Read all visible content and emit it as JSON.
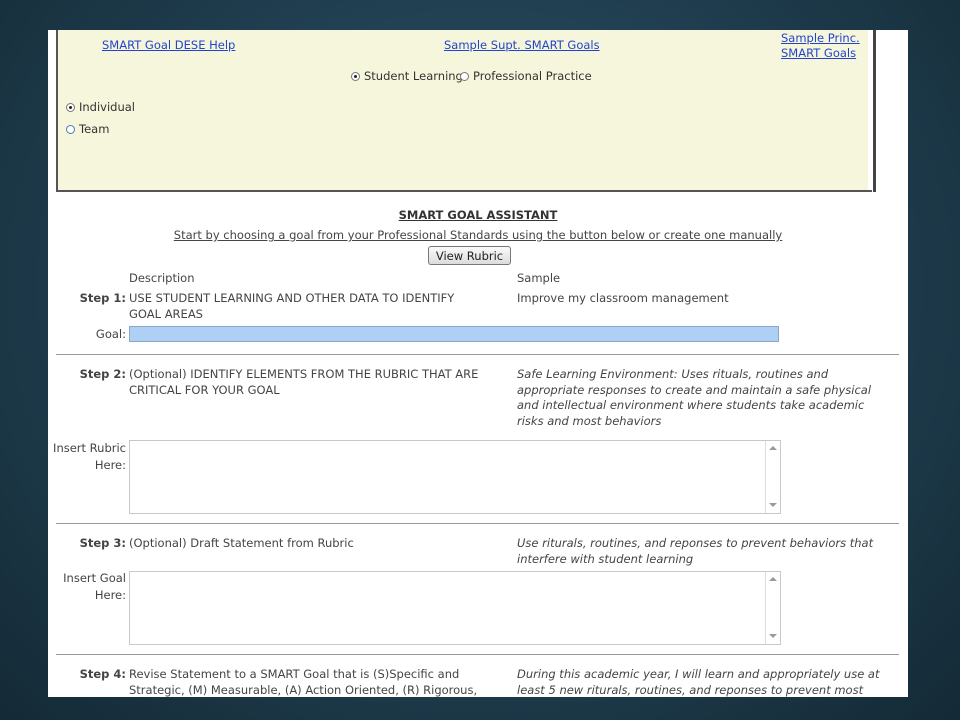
{
  "links": {
    "dese_help": "SMART Goal DESE Help",
    "sample_supt": "Sample Supt. SMART Goals",
    "sample_princ_line1": "Sample Princ.",
    "sample_princ_line2": "SMART Goals"
  },
  "goal_type": {
    "student_learning": "Student Learning",
    "professional_practice": "Professional Practice",
    "selected": "Student Learning"
  },
  "scope": {
    "individual": "Individual",
    "team": "Team",
    "selected": "Individual"
  },
  "assistant": {
    "title": "SMART GOAL ASSISTANT",
    "subtitle": "Start by choosing a goal from your Professional Standards using the button below or create one manually",
    "view_rubric_button": "View Rubric",
    "col_description": "Description",
    "col_sample": "Sample"
  },
  "steps": {
    "step1": {
      "label": "Step 1:",
      "desc_l1": "USE STUDENT LEARNING AND OTHER DATA TO IDENTIFY",
      "desc_l2": "GOAL AREAS",
      "sample": "Improve my classroom management",
      "goal_label": "Goal:",
      "goal_value": ""
    },
    "step2": {
      "label": "Step 2:",
      "desc_l1": "(Optional) IDENTIFY ELEMENTS FROM THE RUBRIC THAT ARE",
      "desc_l2": "CRITICAL FOR YOUR GOAL",
      "sample_l1": "Safe Learning Environment: Uses rituals, routines and",
      "sample_l2": "appropriate responses to create and maintain a safe physical",
      "sample_l3": "and intellectual environment where students take academic",
      "sample_l4": "risks and most behaviors",
      "field_label_l1": "Insert Rubric",
      "field_label_l2": "Here:"
    },
    "step3": {
      "label": "Step 3:",
      "desc": "(Optional) Draft Statement from Rubric",
      "sample_l1": "Use riturals, routines, and reponses to prevent behaviors that",
      "sample_l2": "interfere with student learning",
      "field_label_l1": "Insert Goal",
      "field_label_l2": "Here:"
    },
    "step4": {
      "label": "Step 4:",
      "desc_l1": "Revise Statement to a SMART Goal that is (S)Specific and",
      "desc_l2": "Strategic, (M) Measurable, (A) Action Oriented, (R) Rigorous,",
      "sample_l1": "During this academic year, I will learn and appropriately use at",
      "sample_l2": "least 5 new riturals, routines, and reponses to prevent most"
    }
  },
  "colors": {
    "top_panel_bg": "#f6f6dc",
    "link": "#2244cc",
    "goal_input_bg": "#aed0f5"
  }
}
